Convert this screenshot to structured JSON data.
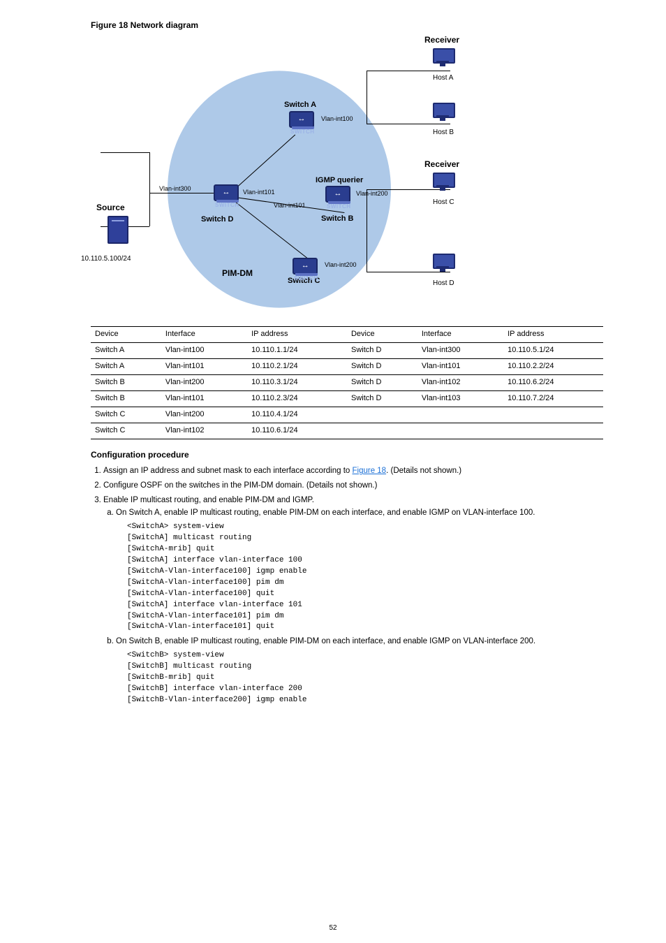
{
  "pageNumber": "52",
  "figure": {
    "caption": "Figure 18 Network diagram",
    "labels": {
      "receiverTop": "Receiver",
      "hostA": "Host A",
      "hostB": "Host B",
      "receiverMid": "Receiver",
      "hostC": "Host C",
      "hostD": "Host D",
      "switchA": "Switch A",
      "switchB": "Switch B",
      "switchC": "Switch C",
      "switchD": "Switch D",
      "igmpQuerier": "IGMP querier",
      "pimDm": "PIM-DM",
      "source": "Source",
      "sourceIp": "10.110.5.100/24",
      "vlanInt100": "Vlan-int100",
      "vlanInt101a": "Vlan-int101",
      "vlanInt101b": "Vlan-int101",
      "vlanInt200a": "Vlan-int200",
      "vlanInt200b": "Vlan-int200",
      "vlanInt300": "Vlan-int300"
    }
  },
  "table": {
    "headers": [
      "Device",
      "Interface",
      "IP address",
      "Device",
      "Interface",
      "IP address"
    ],
    "rows": [
      [
        "Switch A",
        "Vlan-int100",
        "10.110.1.1/24",
        "Switch D",
        "Vlan-int300",
        "10.110.5.1/24"
      ],
      [
        "Switch A",
        "Vlan-int101",
        "10.110.2.1/24",
        "Switch D",
        "Vlan-int101",
        "10.110.2.2/24"
      ],
      [
        "Switch B",
        "Vlan-int200",
        "10.110.3.1/24",
        "Switch D",
        "Vlan-int102",
        "10.110.6.2/24"
      ],
      [
        "Switch B",
        "Vlan-int101",
        "10.110.2.3/24",
        "Switch D",
        "Vlan-int103",
        "10.110.7.2/24"
      ],
      [
        "Switch C",
        "Vlan-int200",
        "10.110.4.1/24",
        "",
        "",
        ""
      ],
      [
        "Switch C",
        "Vlan-int102",
        "10.110.6.1/24",
        "",
        "",
        ""
      ]
    ]
  },
  "sections": {
    "procHeading": "Configuration procedure",
    "step1": "Assign an IP address and subnet mask to each interface according to ",
    "figLink": "Figure 18",
    "step1tail": ". (Details not shown.)",
    "step2": "Configure OSPF on the switches in the PIM-DM domain. (Details not shown.)",
    "step3": "Enable IP multicast routing, and enable PIM-DM and IGMP.",
    "step3a": "On Switch A, enable IP multicast routing, enable PIM-DM on each interface, and enable IGMP on VLAN-interface 100.",
    "cmdA": [
      "<SwitchA> system-view",
      "[SwitchA] multicast routing",
      "[SwitchA-mrib] quit",
      "[SwitchA] interface vlan-interface 100",
      "[SwitchA-Vlan-interface100] igmp enable",
      "[SwitchA-Vlan-interface100] pim dm",
      "[SwitchA-Vlan-interface100] quit",
      "[SwitchA] interface vlan-interface 101",
      "[SwitchA-Vlan-interface101] pim dm",
      "[SwitchA-Vlan-interface101] quit"
    ],
    "step3b": "On Switch B, enable IP multicast routing, enable PIM-DM on each interface, and enable IGMP on VLAN-interface 200.",
    "cmdB": [
      "<SwitchB> system-view",
      "[SwitchB] multicast routing",
      "[SwitchB-mrib] quit",
      "[SwitchB] interface vlan-interface 200",
      "[SwitchB-Vlan-interface200] igmp enable"
    ]
  }
}
